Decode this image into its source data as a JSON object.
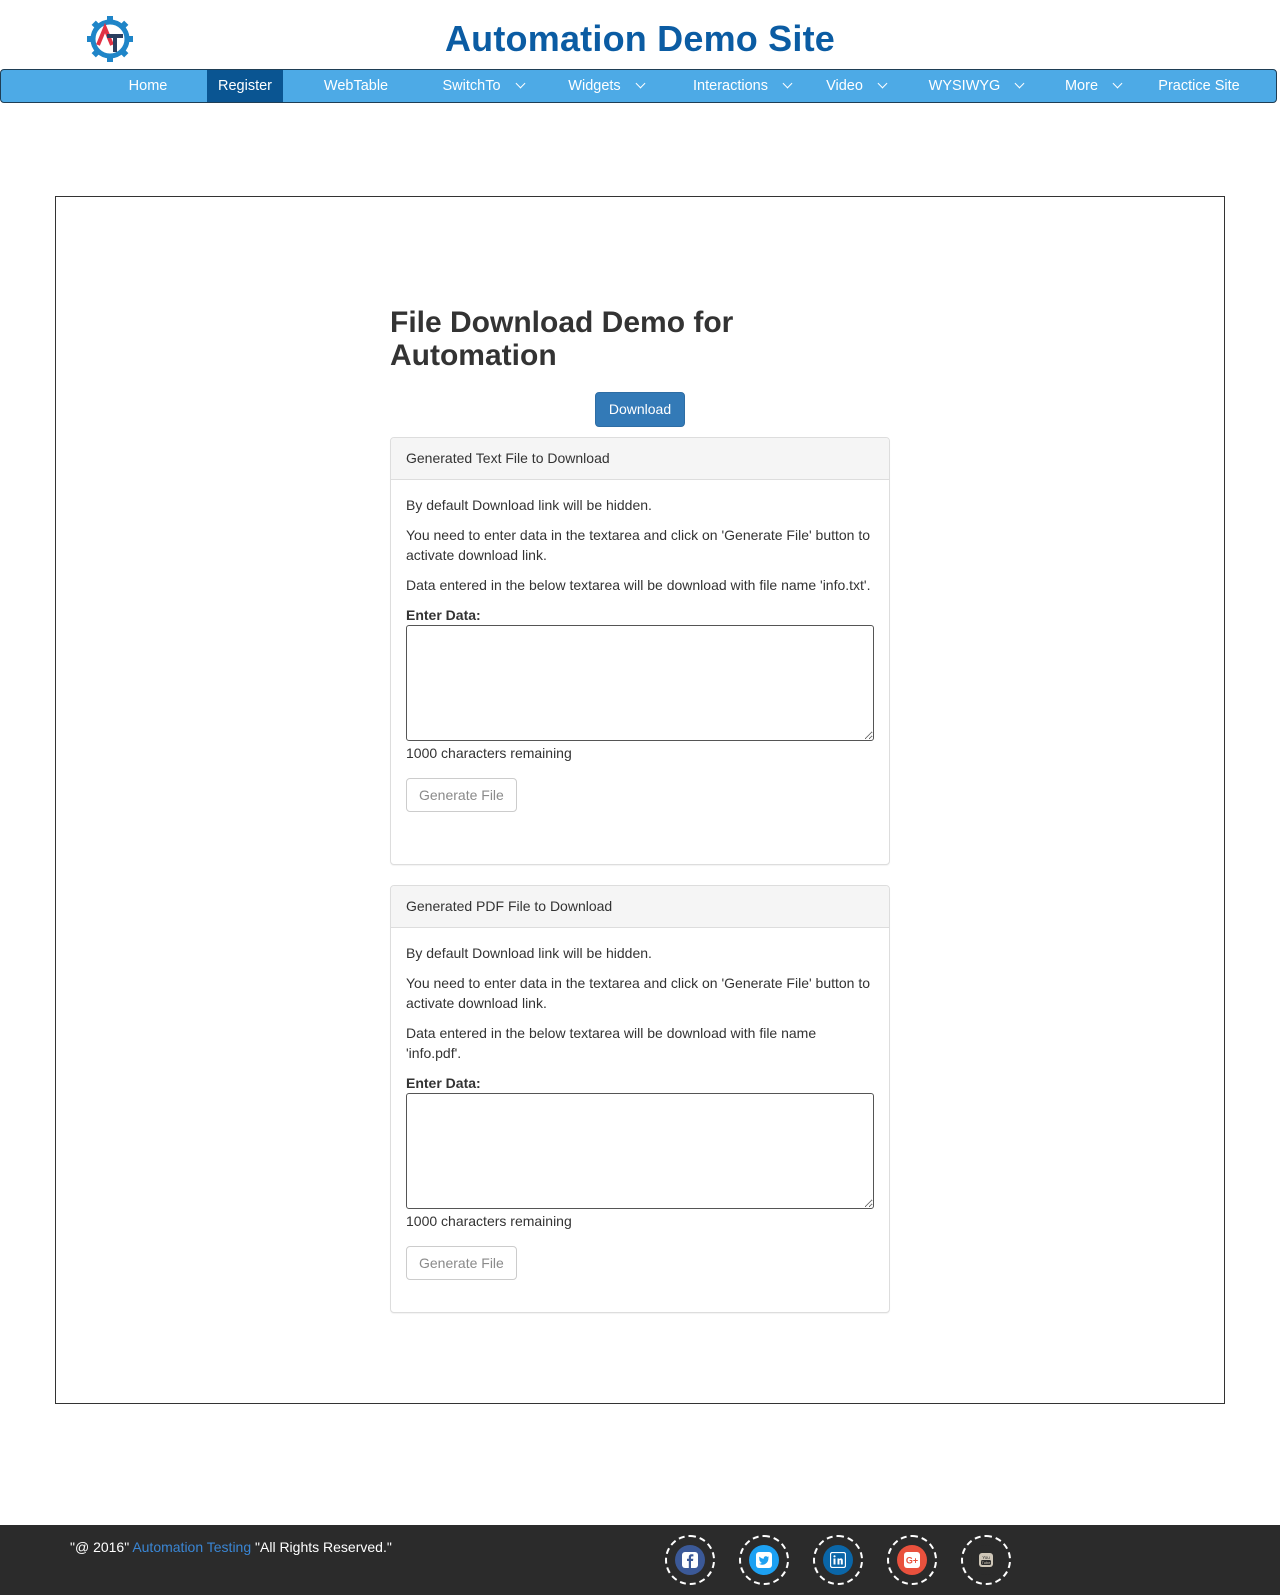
{
  "header": {
    "title": "Automation Demo Site",
    "logo_letters": "AT"
  },
  "nav": {
    "items": [
      {
        "label": "Home",
        "dropdown": false,
        "active": false
      },
      {
        "label": "Register",
        "dropdown": false,
        "active": true
      },
      {
        "label": "WebTable",
        "dropdown": false,
        "active": false
      },
      {
        "label": "SwitchTo",
        "dropdown": true,
        "active": false
      },
      {
        "label": "Widgets",
        "dropdown": true,
        "active": false
      },
      {
        "label": "Interactions",
        "dropdown": true,
        "active": false
      },
      {
        "label": "Video",
        "dropdown": true,
        "active": false
      },
      {
        "label": "WYSIWYG",
        "dropdown": true,
        "active": false
      },
      {
        "label": "More",
        "dropdown": true,
        "active": false
      },
      {
        "label": "Practice Site",
        "dropdown": false,
        "active": false
      }
    ]
  },
  "main": {
    "heading": "File Download Demo for Automation",
    "download_button": "Download",
    "panels": [
      {
        "title": "Generated Text File to Download",
        "line1": "By default Download link will be hidden.",
        "line2": "You need to enter data in the textarea and click on 'Generate File' button to activate download link.",
        "line3": "Data entered in the below textarea will be download with file name 'info.txt'.",
        "label": "Enter Data:",
        "textarea_value": "",
        "remaining": "1000 characters remaining",
        "button": "Generate File"
      },
      {
        "title": "Generated PDF File to Download",
        "line1": "By default Download link will be hidden.",
        "line2": "You need to enter data in the textarea and click on 'Generate File' button to activate download link.",
        "line3": "Data entered in the below textarea will be download with file name 'info.pdf'.",
        "label": "Enter Data:",
        "textarea_value": "",
        "remaining": "1000 characters remaining",
        "button": "Generate File"
      }
    ]
  },
  "footer": {
    "copyright_prefix": "\"@ 2016\"",
    "copyright_link": "Automation Testing",
    "copyright_suffix": "\"All Rights Reserved.\"",
    "social": [
      {
        "icon": "facebook-icon",
        "color": "#3b5998"
      },
      {
        "icon": "twitter-icon",
        "color": "#1da1f2"
      },
      {
        "icon": "linkedin-icon",
        "color": "#0a66a8"
      },
      {
        "icon": "google-plus-icon",
        "color": "#e9513d"
      },
      {
        "icon": "youtube-icon",
        "color": "#2b2b2b"
      }
    ]
  },
  "colors": {
    "brand": "#0b5ca3",
    "navbar": "#4daae6",
    "nav_active": "#0a5592",
    "primary_button": "#337ab7",
    "footer": "#2b2b2b"
  }
}
